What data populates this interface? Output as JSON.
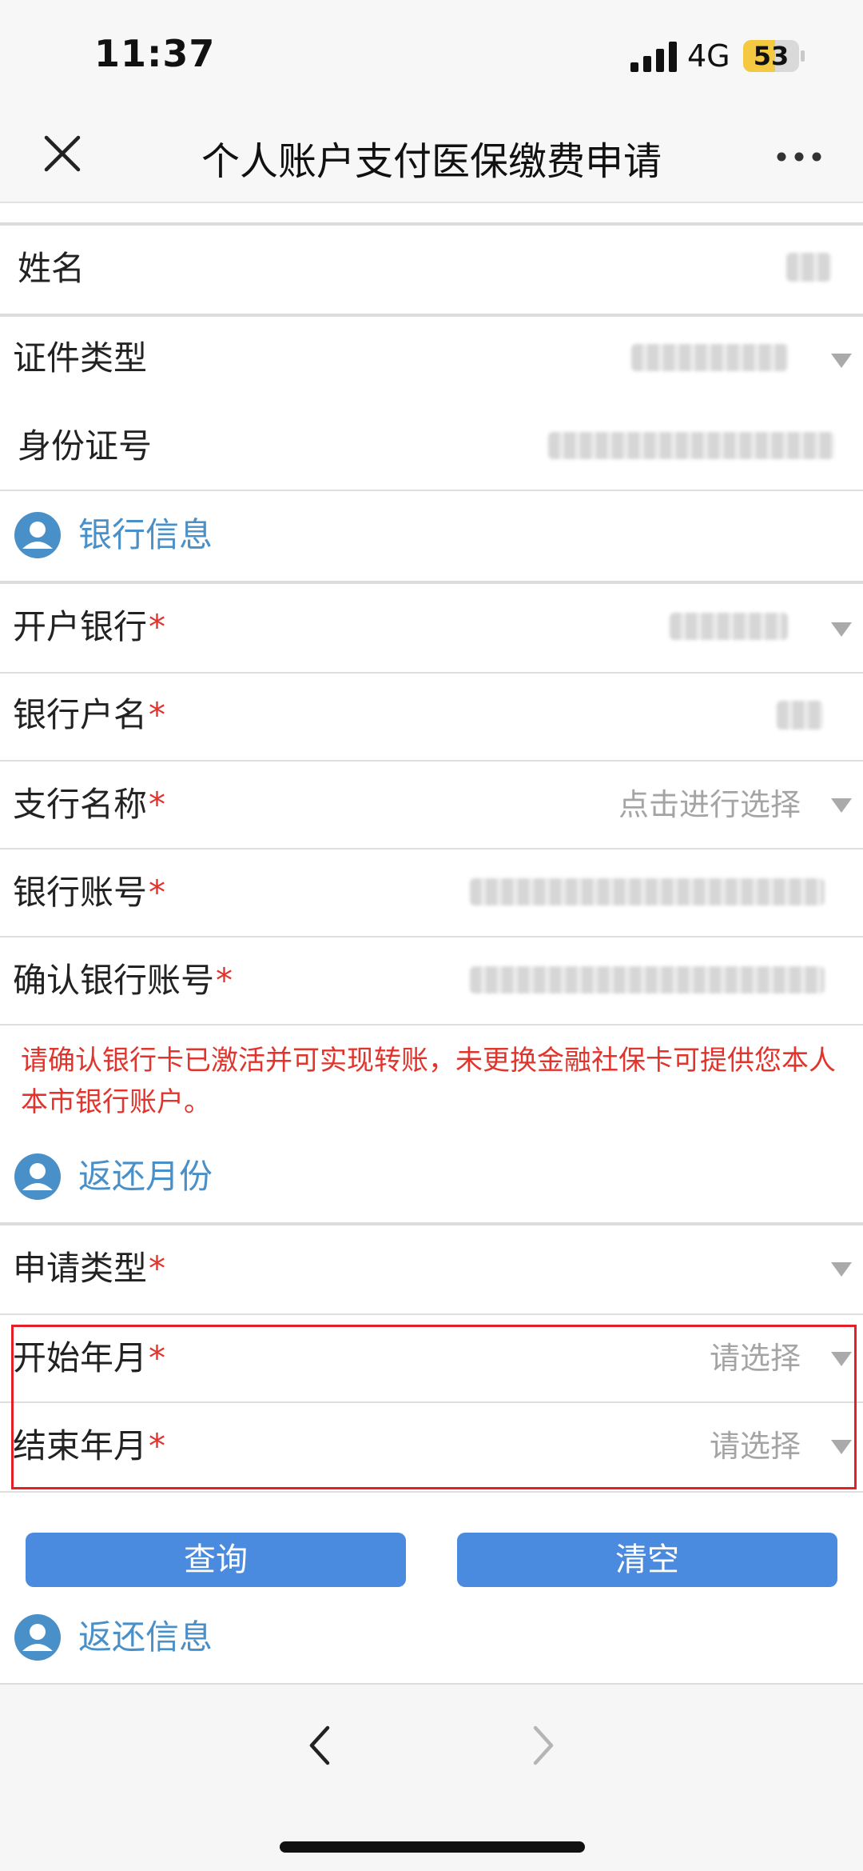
{
  "status_bar": {
    "time": "11:37",
    "network": "4G",
    "battery": "53"
  },
  "nav": {
    "title": "个人账户支付医保缴费申请",
    "close_icon": "close-icon",
    "more_icon": "more-icon"
  },
  "colors": {
    "section_title": "#4a90c8",
    "required_mark": "#e0342c",
    "button_bg": "#4a8bdf",
    "highlight_border": "#e3202a"
  },
  "personal": {
    "name_label": "姓名",
    "id_type_label": "证件类型",
    "id_number_label": "身份证号"
  },
  "bank_section": {
    "title": "银行信息",
    "bank_label": "开户银行",
    "account_name_label": "银行户名",
    "branch_label": "支行名称",
    "branch_placeholder": "点击进行选择",
    "account_number_label": "银行账号",
    "confirm_account_label": "确认银行账号",
    "required_mark": "*",
    "notice": "请确认银行卡已激活并可实现转账，未更换金融社保卡可提供您本人本市银行账户。"
  },
  "refund_month_section": {
    "title": "返还月份",
    "apply_type_label": "申请类型",
    "start_label": "开始年月",
    "start_placeholder": "请选择",
    "end_label": "结束年月",
    "end_placeholder": "请选择"
  },
  "actions": {
    "query_label": "查询",
    "clear_label": "清空"
  },
  "refund_info_section": {
    "title": "返还信息"
  }
}
